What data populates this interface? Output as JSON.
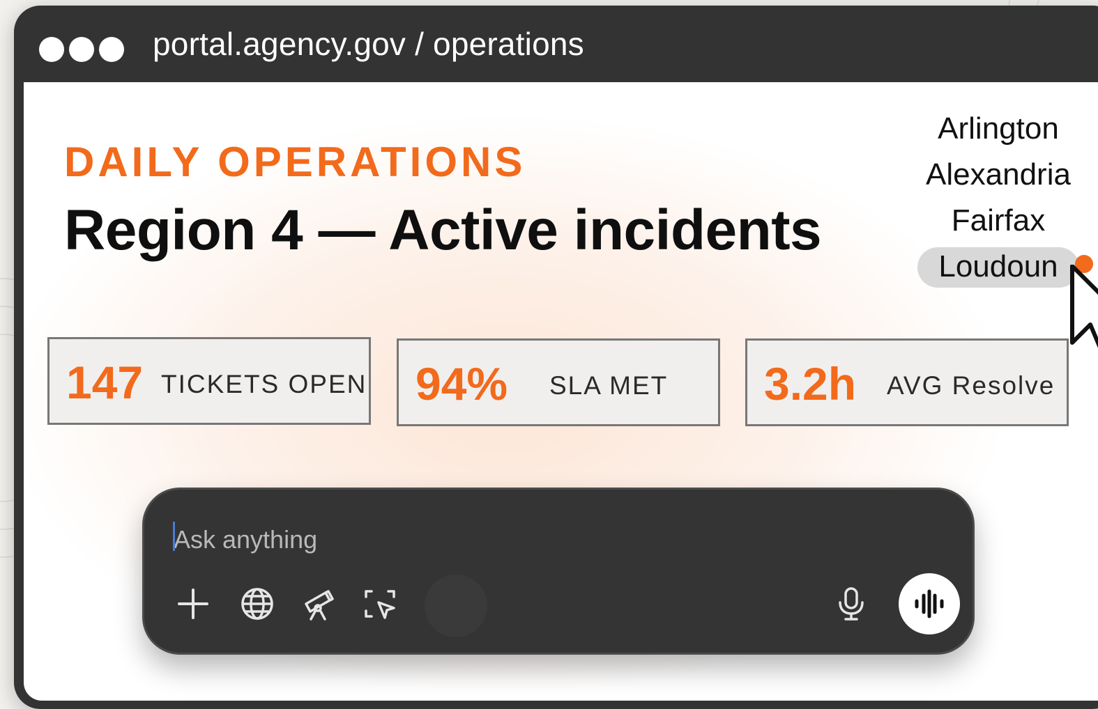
{
  "window": {
    "url": "portal.agency.gov / operations"
  },
  "header": {
    "overline": "DAILY OPERATIONS",
    "title": "Region 4 — Active incidents"
  },
  "regions": {
    "items": [
      "Arlington",
      "Alexandria",
      "Fairfax",
      "Loudoun"
    ],
    "selected": "Loudoun"
  },
  "stats": [
    {
      "value": "147",
      "label": "TICKETS OPEN"
    },
    {
      "value": "94%",
      "label": "SLA MET"
    },
    {
      "value": "3.2h",
      "label": "AVG Resolve"
    }
  ],
  "composer": {
    "placeholder": "Ask anything",
    "icons": [
      "plus-icon",
      "globe-icon",
      "telescope-icon",
      "select-region-icon",
      "microphone-icon",
      "voice-waveform-icon"
    ]
  },
  "colors": {
    "accent": "#f26a1b",
    "window_chrome": "#333333",
    "composer_bg": "#343434"
  }
}
